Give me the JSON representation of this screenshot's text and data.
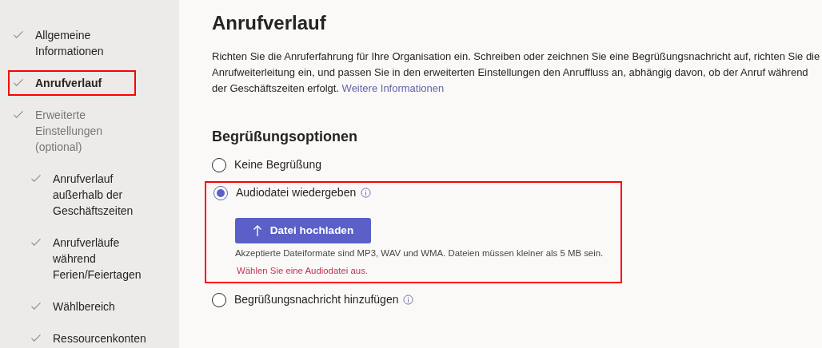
{
  "sidebar": {
    "items": [
      {
        "label": "Allgemeine Informationen",
        "checked": true,
        "selected": false,
        "disabled": false,
        "highlighted": false
      },
      {
        "label": "Anrufverlauf",
        "checked": true,
        "selected": true,
        "disabled": false,
        "highlighted": true
      },
      {
        "label": "Erweiterte Einstellungen (optional)",
        "checked": true,
        "selected": false,
        "disabled": true,
        "highlighted": false,
        "children": [
          {
            "label": "Anrufverlauf außerhalb der Geschäftszeiten",
            "checked": true,
            "selected": false,
            "disabled": false,
            "highlighted": false
          },
          {
            "label": "Anrufverläufe während Ferien/Feiertagen",
            "checked": true,
            "selected": false,
            "disabled": false,
            "highlighted": false
          },
          {
            "label": "Wählbereich",
            "checked": true,
            "selected": false,
            "disabled": false,
            "highlighted": false
          },
          {
            "label": "Ressourcenkonten",
            "checked": true,
            "selected": false,
            "disabled": false,
            "highlighted": false
          }
        ]
      }
    ]
  },
  "page": {
    "title": "Anrufverlauf",
    "description": "Richten Sie die Anruferfahrung für Ihre Organisation ein. Schreiben oder zeichnen Sie eine Begrüßungsnachricht auf, richten Sie die Anrufweiterleitung ein, und passen Sie in den erweiterten Einstellungen den Anruffluss an, abhängig davon, ob der Anruf während der Geschäftszeiten erfolgt.",
    "link": "Weitere Informationen"
  },
  "greeting": {
    "heading": "Begrüßungsoptionen",
    "options": [
      {
        "label": "Keine Begrüßung",
        "selected": false,
        "info": false,
        "highlighted": false
      },
      {
        "label": "Audiodatei wiedergeben",
        "selected": true,
        "info": true,
        "highlighted": true,
        "upload": {
          "button": "Datei hochladen",
          "hint": "Akzeptierte Dateiformate sind MP3, WAV und WMA. Dateien müssen kleiner als 5 MB sein.",
          "error": "Wählen Sie eine Audiodatei aus."
        }
      },
      {
        "label": "Begrüßungsnachricht hinzufügen",
        "selected": false,
        "info": true,
        "highlighted": false
      }
    ]
  }
}
